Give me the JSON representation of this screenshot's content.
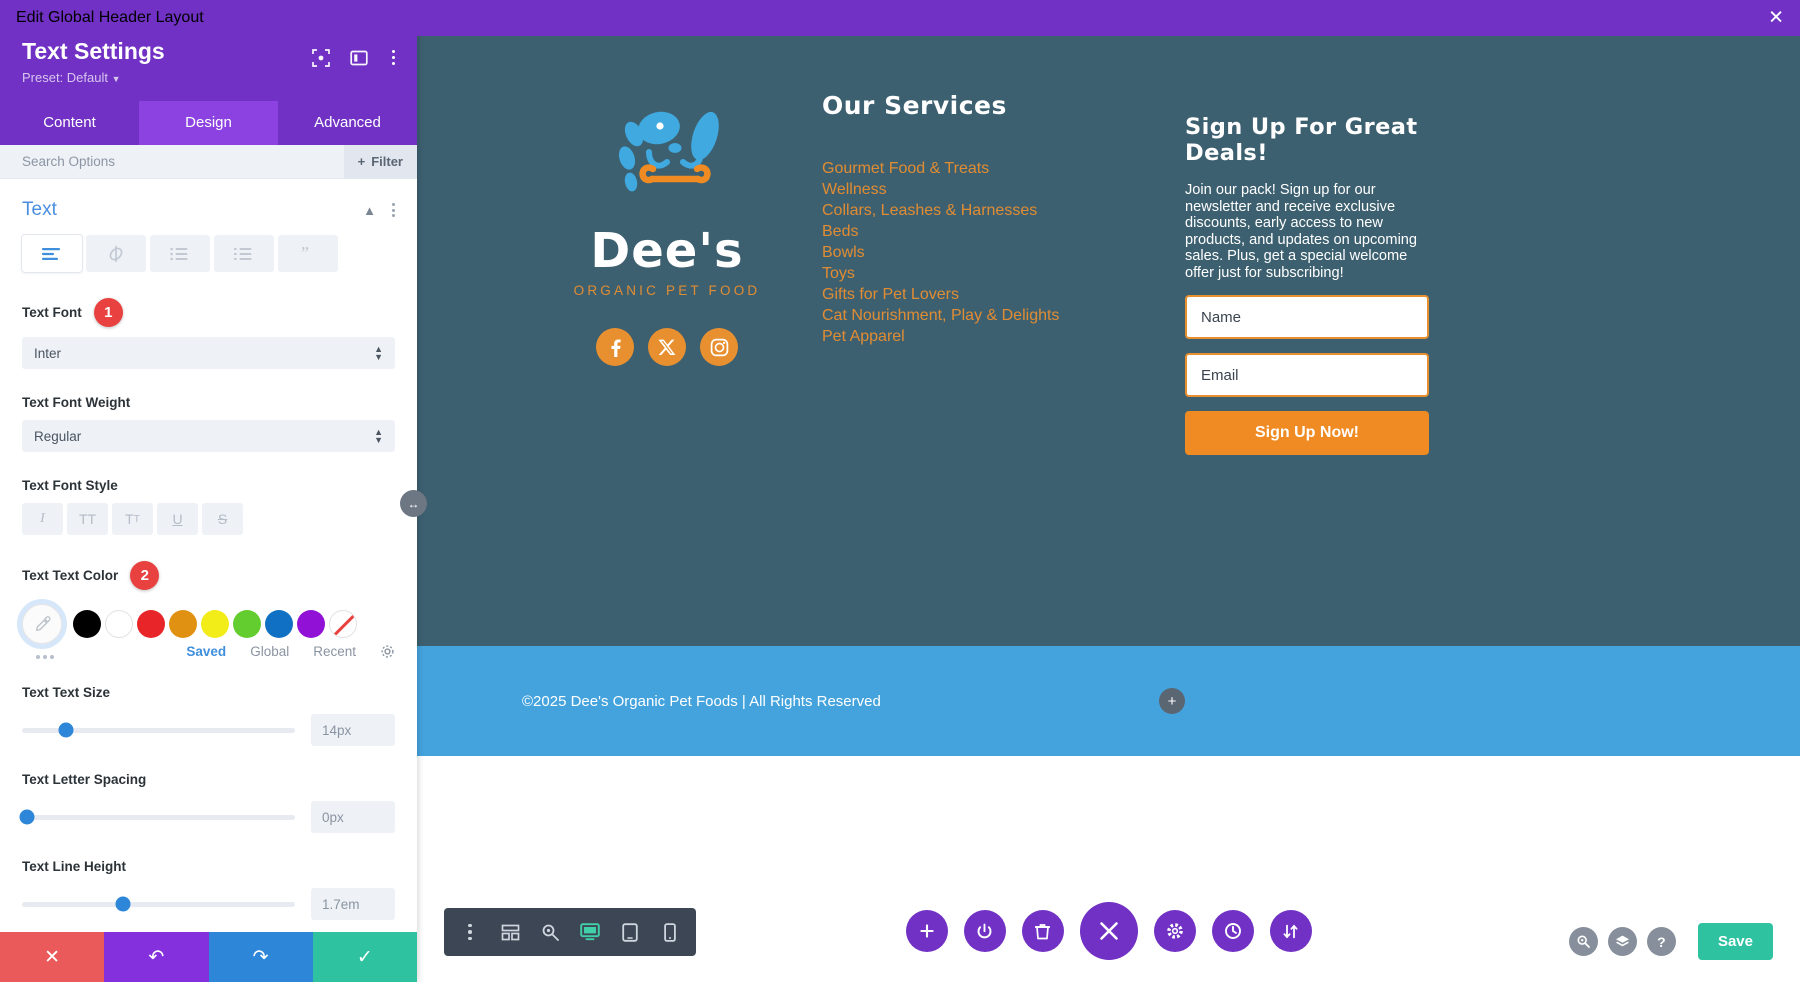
{
  "titlebar": {
    "title": "Edit Global Header Layout",
    "close_icon": "close-icon"
  },
  "panel": {
    "title": "Text Settings",
    "preset": "Preset: Default",
    "tabs": [
      {
        "label": "Content",
        "active": false
      },
      {
        "label": "Design",
        "active": true
      },
      {
        "label": "Advanced",
        "active": false
      }
    ],
    "search_placeholder": "Search Options",
    "filter_label": "Filter",
    "section": {
      "title": "Text"
    },
    "align_buttons": [
      "align-text-icon",
      "link-off-icon",
      "unordered-list-icon",
      "ordered-list-icon",
      "quote-icon"
    ],
    "fields": {
      "font": {
        "label": "Text Font",
        "value": "Inter",
        "badge": "1"
      },
      "font_weight": {
        "label": "Text Font Weight",
        "value": "Regular"
      },
      "font_style": {
        "label": "Text Font Style",
        "buttons": [
          "italic-icon",
          "uppercase-icon",
          "capitalize-icon",
          "underline-icon",
          "strikethrough-icon"
        ]
      },
      "text_color": {
        "label": "Text Text Color",
        "badge": "2",
        "swatches": [
          "#000000",
          "#ffffff",
          "#e8262a",
          "#e09112",
          "#f2ec19",
          "#63cc2e",
          "#1071c4",
          "#9112d6"
        ],
        "tabs": [
          {
            "label": "Saved",
            "active": true
          },
          {
            "label": "Global",
            "active": false
          },
          {
            "label": "Recent",
            "active": false
          }
        ]
      },
      "text_size": {
        "label": "Text Text Size",
        "value": "14px",
        "percent": 16
      },
      "letter_spacing": {
        "label": "Text Letter Spacing",
        "value": "0px",
        "percent": 2
      },
      "line_height": {
        "label": "Text Line Height",
        "value": "1.7em",
        "percent": 37
      }
    },
    "footer_buttons": [
      {
        "name": "cancel",
        "icon": "close-icon"
      },
      {
        "name": "undo",
        "icon": "undo-icon"
      },
      {
        "name": "redo",
        "icon": "redo-icon"
      },
      {
        "name": "confirm",
        "icon": "check-icon"
      }
    ]
  },
  "preview": {
    "logo": {
      "word": "Dee's",
      "sub": "ORGANIC PET FOOD"
    },
    "socials": [
      "facebook-icon",
      "x-twitter-icon",
      "instagram-icon"
    ],
    "services": {
      "heading": "Our Services",
      "items": [
        "Gourmet Food & Treats",
        "Wellness",
        "Collars, Leashes & Harnesses",
        "Beds",
        "Bowls",
        "Toys",
        "Gifts for Pet Lovers",
        "Cat Nourishment, Play & Delights",
        "Pet Apparel"
      ]
    },
    "signup": {
      "heading": "Sign Up For Great Deals!",
      "body": "Join our pack! Sign up for our newsletter and receive exclusive discounts, early access to new products, and updates on upcoming sales. Plus, get a special welcome offer just for subscribing!",
      "name_placeholder": "Name",
      "email_placeholder": "Email",
      "button_label": "Sign Up Now!"
    },
    "copyright": "©2025 Dee's Organic Pet Foods | All Rights Reserved"
  },
  "bottom": {
    "view_toolbar": [
      "kebab-icon",
      "wireframe-icon",
      "zoom-icon",
      "desktop-icon",
      "tablet-icon",
      "phone-icon"
    ],
    "center_actions": [
      "plus-icon",
      "power-icon",
      "trash-icon",
      "close-icon",
      "gear-icon",
      "history-icon",
      "sort-icon"
    ],
    "right_actions": [
      "search-icon",
      "layers-icon",
      "help-icon"
    ],
    "save_label": "Save"
  },
  "colors": {
    "purple": "#7131c4",
    "orange": "#e8902f",
    "teal_dark": "#3d6070",
    "blue": "#44a3dd",
    "green": "#2ec2a1"
  }
}
